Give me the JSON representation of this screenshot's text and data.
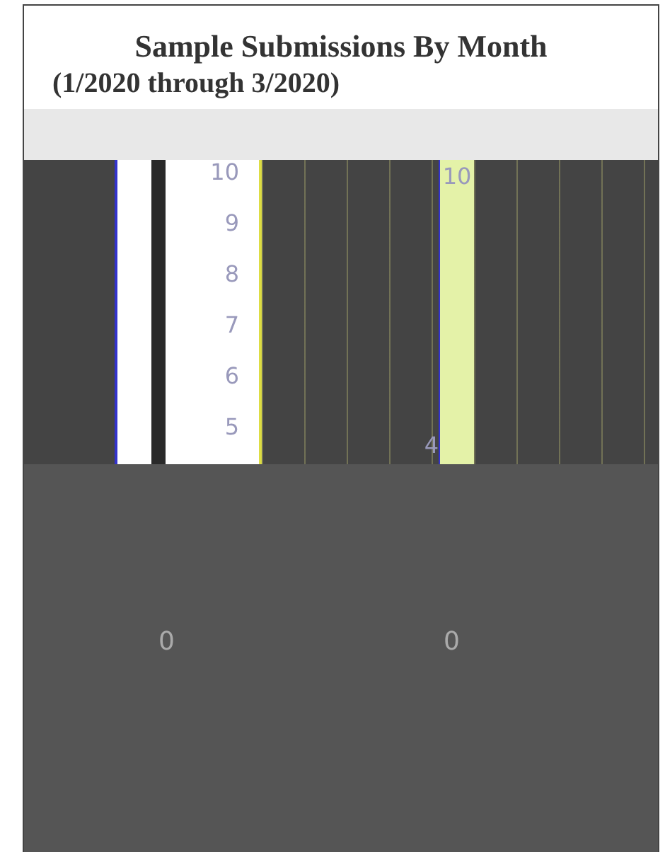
{
  "chart": {
    "title": "Sample Submissions By Month",
    "subtitle": "(1/2020 through 3/2020)",
    "y_ticks": [
      "10",
      "9",
      "8",
      "7",
      "6",
      "5"
    ],
    "bar_label": "10",
    "value_labels": [
      "4"
    ],
    "zero_labels": [
      "0",
      "0"
    ]
  }
}
